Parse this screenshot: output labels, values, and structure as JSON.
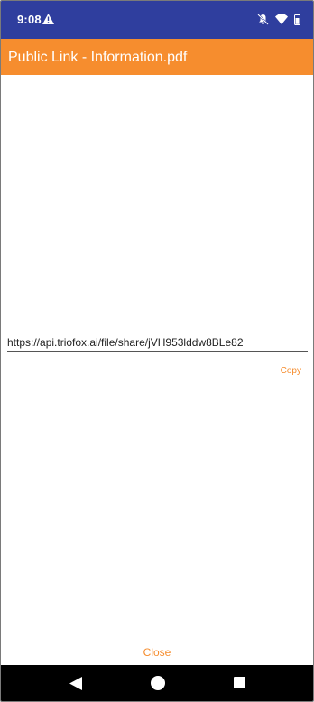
{
  "status_bar": {
    "time": "9:08",
    "icons": [
      "warning-icon",
      "mute-icon",
      "wifi-icon",
      "battery-icon"
    ]
  },
  "app_bar": {
    "title": "Public Link - Information.pdf",
    "color": "#f68d2e"
  },
  "link": {
    "value": "https://api.triofox.ai/file/share/jVH953lddw8BLe82"
  },
  "actions": {
    "copy_label": "Copy",
    "close_label": "Close"
  },
  "nav_bar": {
    "buttons": [
      "back-icon",
      "home-icon",
      "recents-icon"
    ]
  },
  "colors": {
    "status_bar": "#2f3e9e",
    "accent": "#f68d2e"
  }
}
